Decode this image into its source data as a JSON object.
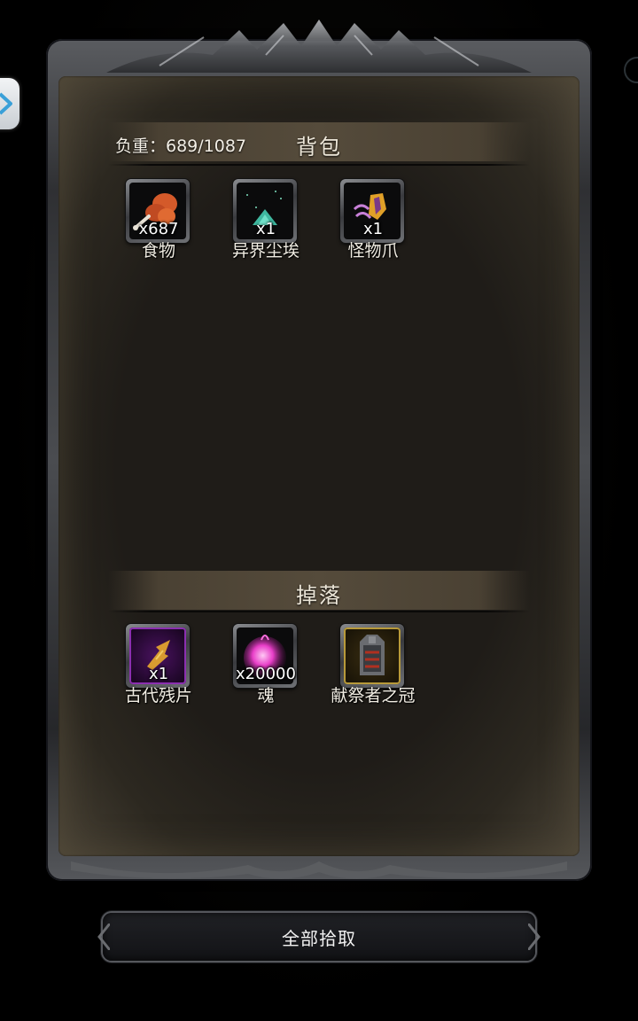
{
  "inventory": {
    "title": "背包",
    "weight_text": "负重：689/1087",
    "items": [
      {
        "name": "食物",
        "qty": "x687",
        "icon": "food-drumstick-icon"
      },
      {
        "name": "异界尘埃",
        "qty": "x1",
        "icon": "otherworld-dust-icon"
      },
      {
        "name": "怪物爪",
        "qty": "x1",
        "icon": "monster-claw-icon"
      }
    ]
  },
  "drops": {
    "title": "掉落",
    "items": [
      {
        "name": "古代残片",
        "qty": "x1",
        "icon": "ancient-fragment-icon",
        "rarity_color": "#8b2fb0"
      },
      {
        "name": "魂",
        "qty": "x20000",
        "icon": "soul-orb-icon"
      },
      {
        "name": "献祭者之冠",
        "qty": "",
        "icon": "sacrificer-crown-icon",
        "rarity_color": "#b89a3a"
      }
    ]
  },
  "actions": {
    "pick_all_label": "全部拾取"
  }
}
